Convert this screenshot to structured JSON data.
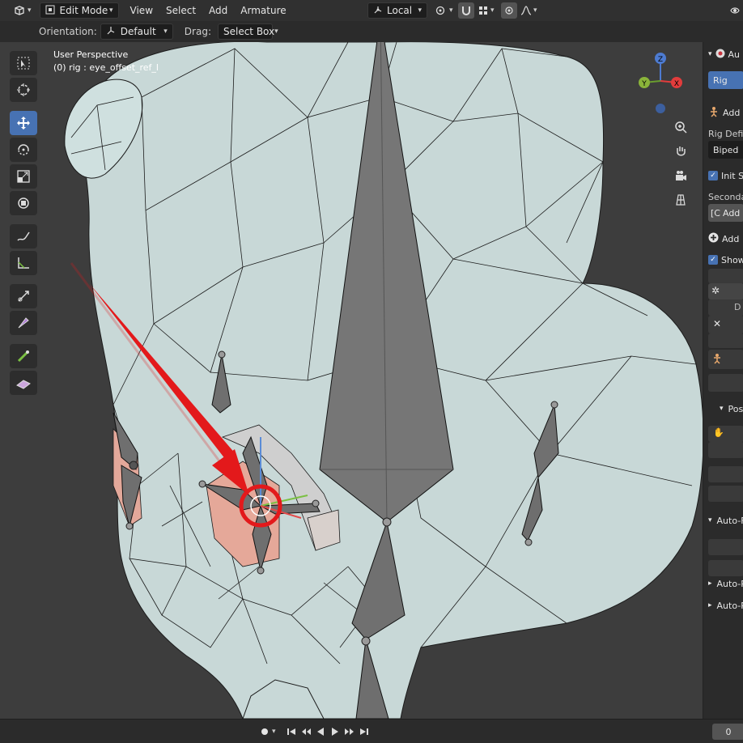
{
  "header": {
    "editor_icon": "view3d-icon",
    "mode": "Edit Mode",
    "menus": [
      "View",
      "Select",
      "Add",
      "Armature"
    ],
    "transform_orientation": "Local"
  },
  "toolsettings": {
    "orientation_label": "Orientation:",
    "orientation_value": "Default",
    "drag_label": "Drag:",
    "drag_value": "Select Box"
  },
  "viewport": {
    "perspective": "User Perspective",
    "object_info": "(0) rig : eye_offset_ref_l"
  },
  "toolbar": {
    "tools": [
      "select-box",
      "cursor",
      "move",
      "rotate",
      "scale",
      "transform",
      "annotate",
      "measure",
      "roll",
      "bone-size",
      "extrude",
      "envelope"
    ],
    "active": "move"
  },
  "gizmo": {
    "x": "X",
    "y": "Y",
    "z": "Z"
  },
  "sidebar": {
    "panel_title": "Au",
    "rig_button": "Rig",
    "add_label": "Add",
    "rig_def_label": "Rig Defin",
    "rig_type": "Biped",
    "init_label": "Init Sc",
    "secondary_label": "Secondar",
    "add_label_2": "Add",
    "add_label_3": "Add",
    "show_label": "Show",
    "d_label": "D",
    "pose_label": "Pos",
    "autor_label_1": "Auto-F",
    "autor_label_2": "Auto-R",
    "autor_label_3": "Auto-R"
  },
  "timeline": {
    "frame": "0"
  },
  "colors": {
    "accent": "#4772b3",
    "mesh": "#c6d7d6",
    "bone": "#7a7a7a",
    "highlight": "#e8a79c",
    "annotation": "#e3191b"
  }
}
